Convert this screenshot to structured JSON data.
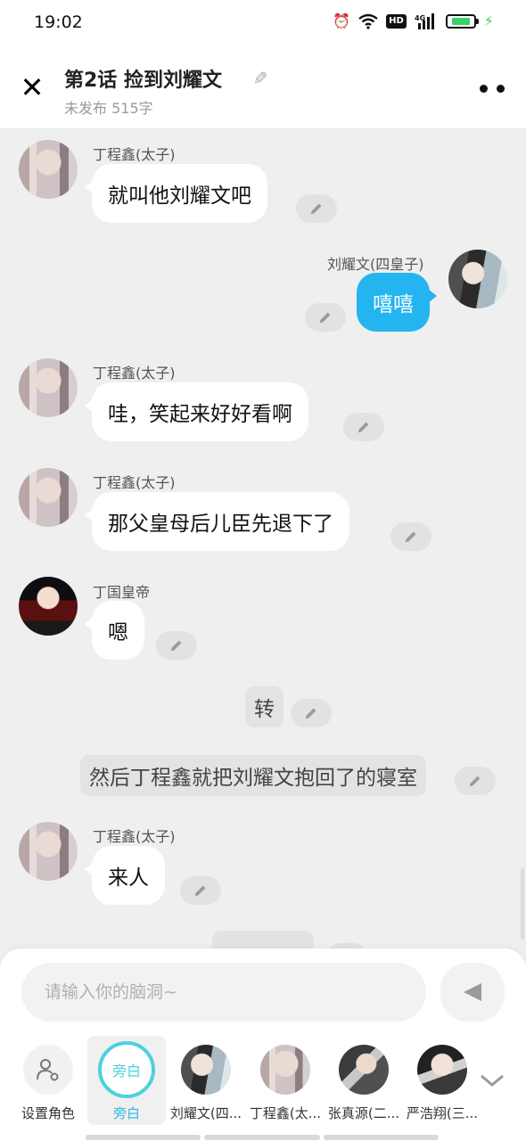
{
  "status_bar": {
    "time": "19:02",
    "icons": [
      "alarm-icon",
      "wifi-icon",
      "hd-icon",
      "4g-signal-icon",
      "battery-icon",
      "charging-icon"
    ],
    "hd_label": "HD",
    "network_label": "4G"
  },
  "header": {
    "title": "第2话  捡到刘耀文",
    "subtitle": "未发布 515字"
  },
  "messages": [
    {
      "sender": "丁程鑫(太子)",
      "text": "就叫他刘耀文吧"
    },
    {
      "sender": "刘耀文(四皇子)",
      "text": "嘻嘻"
    },
    {
      "sender": "丁程鑫(太子)",
      "text": "哇，笑起来好好看啊"
    },
    {
      "sender": "丁程鑫(太子)",
      "text": "那父皇母后儿臣先退下了"
    },
    {
      "sender": "丁国皇帝",
      "text": "嗯"
    },
    {
      "narration": "转"
    },
    {
      "narration": "然后丁程鑫就把刘耀文抱回了的寝室"
    },
    {
      "sender": "丁程鑫(太子)",
      "text": "来人"
    }
  ],
  "composer": {
    "placeholder": "请输入你的脑洞~"
  },
  "roles": [
    {
      "label": "设置角色"
    },
    {
      "label": "旁白",
      "badge": "旁白"
    },
    {
      "label": "刘耀文(四..."
    },
    {
      "label": "丁程鑫(太..."
    },
    {
      "label": "张真源(二..."
    },
    {
      "label": "严浩翔(三..."
    }
  ],
  "colors": {
    "accent_blue": "#24b4f0",
    "narrator_teal": "#4dd0e1",
    "background": "#efefef"
  }
}
